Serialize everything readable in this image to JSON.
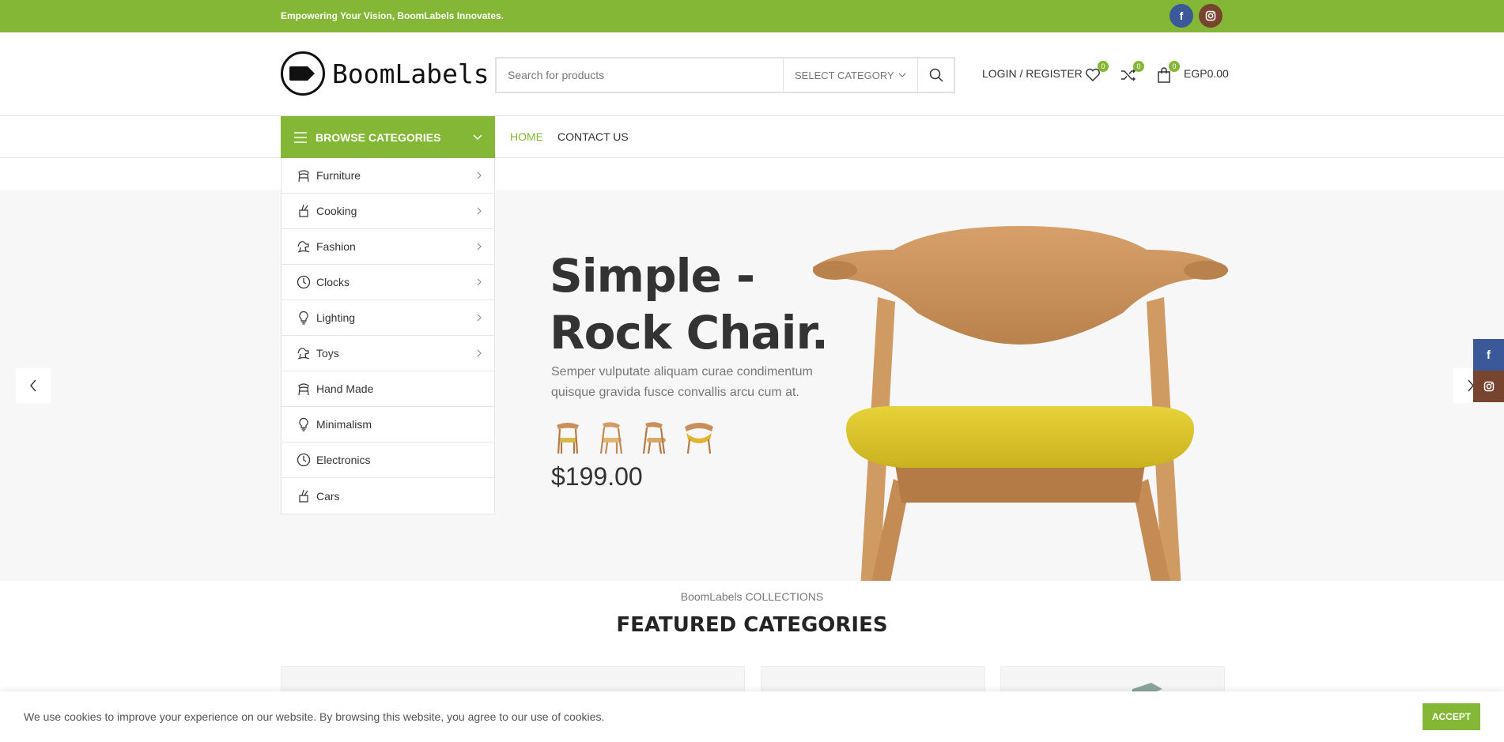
{
  "topbar": {
    "tagline": "Empowering Your Vision, BoomLabels Innovates.",
    "social": [
      {
        "name": "facebook",
        "glyph": "f",
        "color": "#3b5998"
      },
      {
        "name": "instagram",
        "glyph": "◎",
        "color": "#774430"
      }
    ]
  },
  "header": {
    "brand": "BoomLabels",
    "search_placeholder": "Search for products",
    "select_category": "SELECT CATEGORY",
    "login_label": "LOGIN / REGISTER",
    "wishlist_count": "0",
    "compare_count": "0",
    "cart_count": "0",
    "cart_amount": "EGP0.00"
  },
  "nav": {
    "browse_label": "BROWSE CATEGORIES",
    "links": [
      {
        "label": "HOME",
        "active": true
      },
      {
        "label": "CONTACT US",
        "active": false
      }
    ]
  },
  "categories": [
    {
      "label": "Furniture",
      "icon": "chair-icon",
      "has_children": true
    },
    {
      "label": "Cooking",
      "icon": "cooking-icon",
      "has_children": true
    },
    {
      "label": "Fashion",
      "icon": "toy-horse-icon",
      "has_children": true
    },
    {
      "label": "Clocks",
      "icon": "clock-icon",
      "has_children": true
    },
    {
      "label": "Lighting",
      "icon": "bulb-icon",
      "has_children": true
    },
    {
      "label": "Toys",
      "icon": "toy-horse-icon",
      "has_children": true
    },
    {
      "label": "Hand Made",
      "icon": "chair-icon",
      "has_children": false
    },
    {
      "label": "Minimalism",
      "icon": "bulb-icon",
      "has_children": false
    },
    {
      "label": "Electronics",
      "icon": "clock-icon",
      "has_children": false
    },
    {
      "label": "Cars",
      "icon": "cooking-icon",
      "has_children": false
    }
  ],
  "hero": {
    "title_line1": "Simple -",
    "title_line2": "Rock Chair.",
    "subtitle": "Semper vulputate aliquam curae condimentum quisque gravida fusce convallis arcu cum at.",
    "price": "$199.00",
    "slide_count": 3,
    "active_slide": 1
  },
  "section": {
    "kicker": "BoomLabels COLLECTIONS",
    "heading": "FEATURED CATEGORIES"
  },
  "cookie": {
    "text": "We use cookies to improve your experience on our website. By browsing this website, you agree to our use of cookies.",
    "accept_label": "ACCEPT"
  },
  "colors": {
    "accent": "#83b735",
    "facebook": "#3b5998",
    "instagram": "#774430"
  }
}
